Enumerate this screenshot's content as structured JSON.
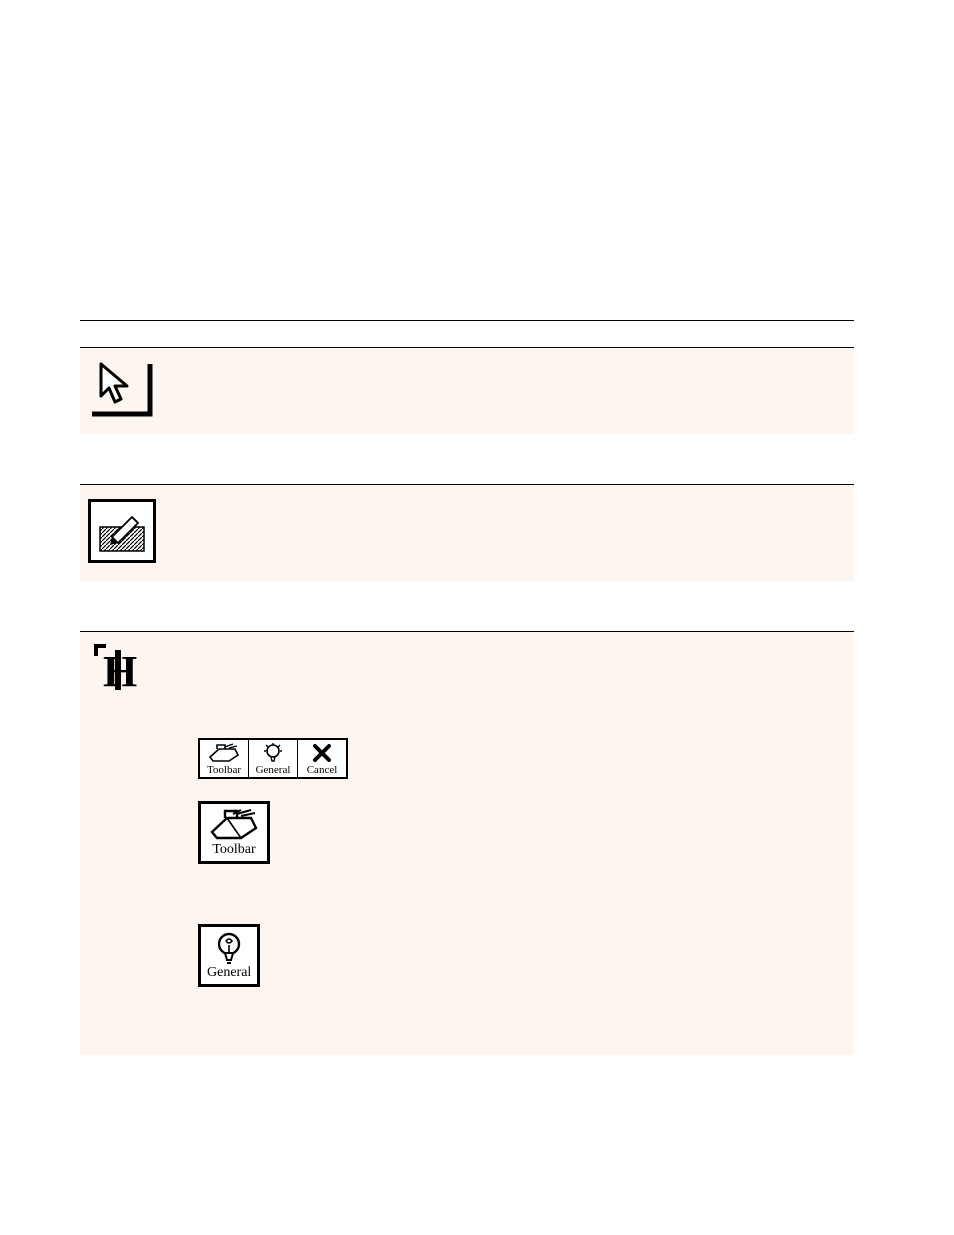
{
  "toolbar": {
    "items": [
      {
        "label": "Toolbar"
      },
      {
        "label": "General"
      },
      {
        "label": "Cancel"
      }
    ],
    "big_buttons": [
      {
        "label": "Toolbar"
      },
      {
        "label": "General"
      }
    ]
  },
  "icons": {
    "pointer_name": "pointer-tool-icon",
    "pencil_name": "pencil-tool-icon",
    "prefs_name": "preferences-icon",
    "toolbox_name": "toolbox-icon",
    "lightbulb_name": "lightbulb-icon",
    "cancel_x_name": "cancel-x-icon"
  }
}
